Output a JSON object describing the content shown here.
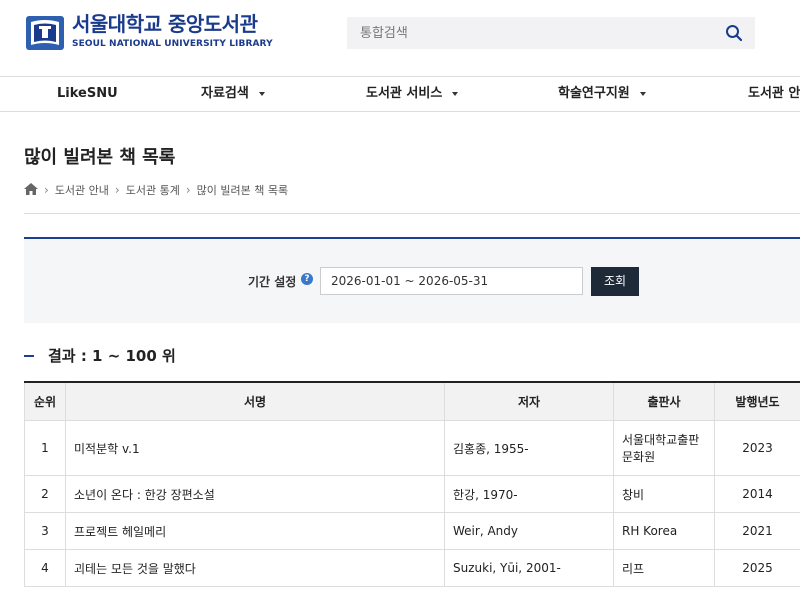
{
  "header": {
    "logo_korean": "서울대학교 중앙도서관",
    "logo_english": "SEOUL NATIONAL UNIVERSITY LIBRARY",
    "search_placeholder": "통합검색"
  },
  "nav": {
    "items": [
      {
        "label": "LikeSNU"
      },
      {
        "label": "자료검색"
      },
      {
        "label": "도서관 서비스"
      },
      {
        "label": "학술연구지원"
      },
      {
        "label": "도서관 안내"
      }
    ]
  },
  "page": {
    "title": "많이 빌려본 책 목록",
    "breadcrumb": [
      "도서관 안내",
      "도서관 통계",
      "많이 빌려본 책 목록"
    ]
  },
  "filter": {
    "label": "기간 설정",
    "help": "?",
    "period": "2026-01-01 ~ 2026-05-31",
    "button": "조회"
  },
  "results": {
    "title": "결과 : 1 ~ 100 위",
    "columns": [
      "순위",
      "서명",
      "저자",
      "출판사",
      "발행년도"
    ],
    "rows": [
      {
        "rank": "1",
        "title": "미적분학 v.1",
        "author": "김홍종, 1955-",
        "publisher_line1": "서울대학교출판",
        "publisher_line2": "문화원",
        "year": "2023"
      },
      {
        "rank": "2",
        "title": "소년이 온다 : 한강 장편소설",
        "author": "한강, 1970-",
        "publisher_line1": "창비",
        "publisher_line2": "",
        "year": "2014"
      },
      {
        "rank": "3",
        "title": "프로젝트 헤일메리",
        "author": "Weir, Andy",
        "publisher_line1": "RH Korea",
        "publisher_line2": "",
        "year": "2021"
      },
      {
        "rank": "4",
        "title": "괴테는 모든 것을 말했다",
        "author": "Suzuki, Yūi, 2001-",
        "publisher_line1": "리프",
        "publisher_line2": "",
        "year": "2025"
      }
    ]
  },
  "colors": {
    "brand_blue": "#1a3a8c",
    "accent_line": "#1e3f8f",
    "button_dark": "#1f2a38"
  }
}
